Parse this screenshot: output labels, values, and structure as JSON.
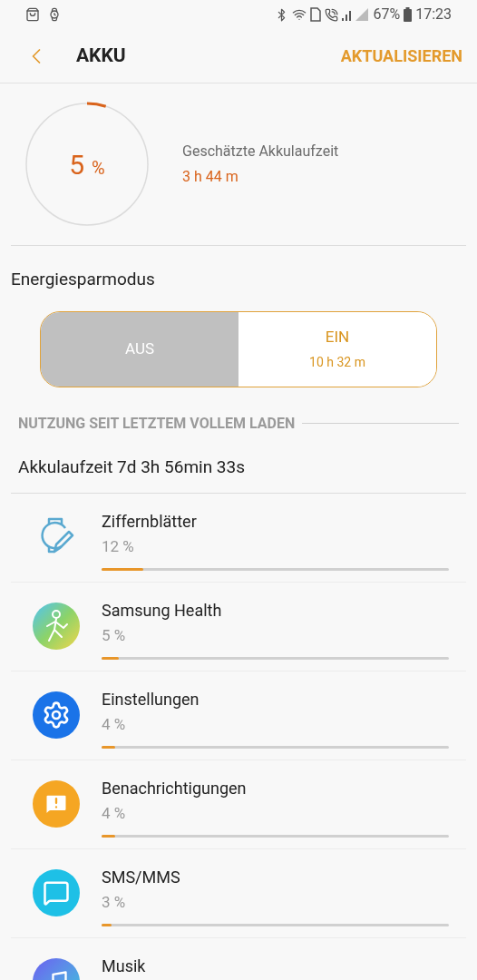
{
  "status_bar": {
    "battery": "67%",
    "time": "17:23"
  },
  "header": {
    "title": "AKKU",
    "action": "AKTUALISIEREN"
  },
  "battery": {
    "percent": "5",
    "unit": "%",
    "level": 0.05,
    "estimate_label": "Geschätzte Akkulaufzeit",
    "estimate": "3 h 44 m"
  },
  "power_saving": {
    "title": "Energiesparmodus",
    "options": [
      {
        "label": "AUS",
        "selected": true
      },
      {
        "label": "EIN",
        "sub": "10 h 32 m",
        "selected": false
      }
    ]
  },
  "usage": {
    "heading": "NUTZUNG SEIT LETZTEM VOLLEM LADEN",
    "uptime": "Akkulaufzeit 7d 3h 56min 33s",
    "apps": [
      {
        "kind": "watchface",
        "name": "Ziffernblätter",
        "percent": "12 %",
        "level": 0.12
      },
      {
        "kind": "health",
        "name": "Samsung Health",
        "percent": "5 %",
        "level": 0.05
      },
      {
        "kind": "settings",
        "name": "Einstellungen",
        "percent": "4 %",
        "level": 0.04
      },
      {
        "kind": "notifications",
        "name": "Benachrichtigungen",
        "percent": "4 %",
        "level": 0.04
      },
      {
        "kind": "messages",
        "name": "SMS/MMS",
        "percent": "3 %",
        "level": 0.03
      },
      {
        "kind": "music",
        "name": "Musik"
      }
    ]
  }
}
